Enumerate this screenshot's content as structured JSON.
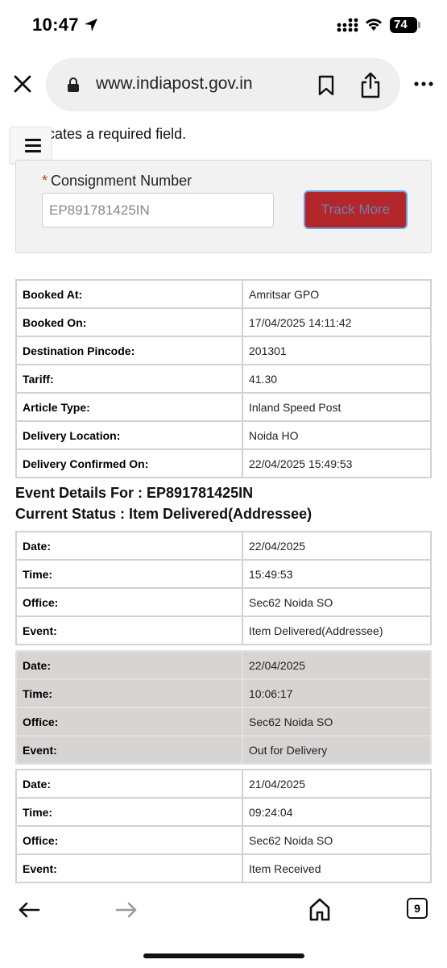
{
  "status_bar": {
    "time": "10:47",
    "battery": "74"
  },
  "browser": {
    "url": "www.indiapost.gov.in",
    "tab_count": "9"
  },
  "page": {
    "required_star": "*",
    "required_note": " Indicates a required field.",
    "form": {
      "label_star": "*",
      "label": "Consignment Number",
      "input_value": "EP891781425IN",
      "button_label": "Track More"
    },
    "booking": [
      {
        "key": "Booked At:",
        "value": "Amritsar GPO"
      },
      {
        "key": "Booked On:",
        "value": "17/04/2025 14:11:42"
      },
      {
        "key": "Destination Pincode:",
        "value": "201301"
      },
      {
        "key": "Tariff:",
        "value": "41.30"
      },
      {
        "key": "Article Type:",
        "value": "Inland Speed Post"
      },
      {
        "key": "Delivery Location:",
        "value": "Noida HO"
      },
      {
        "key": "Delivery Confirmed On:",
        "value": "22/04/2025 15:49:53"
      }
    ],
    "event_details_title": "Event Details For : EP891781425IN",
    "current_status": "Current Status : Item Delivered(Addressee)",
    "events": [
      {
        "date_label": "Date:",
        "date": "22/04/2025",
        "time_label": "Time:",
        "time": "15:49:53",
        "office_label": "Office:",
        "office": "Sec62 Noida SO",
        "event_label": "Event:",
        "event": "Item Delivered(Addressee)"
      },
      {
        "date_label": "Date:",
        "date": "22/04/2025",
        "time_label": "Time:",
        "time": "10:06:17",
        "office_label": "Office:",
        "office": "Sec62 Noida SO",
        "event_label": "Event:",
        "event": "Out for Delivery"
      },
      {
        "date_label": "Date:",
        "date": "21/04/2025",
        "time_label": "Time:",
        "time": "09:24:04",
        "office_label": "Office:",
        "office": "Sec62 Noida SO",
        "event_label": "Event:",
        "event": "Item Received"
      }
    ]
  }
}
